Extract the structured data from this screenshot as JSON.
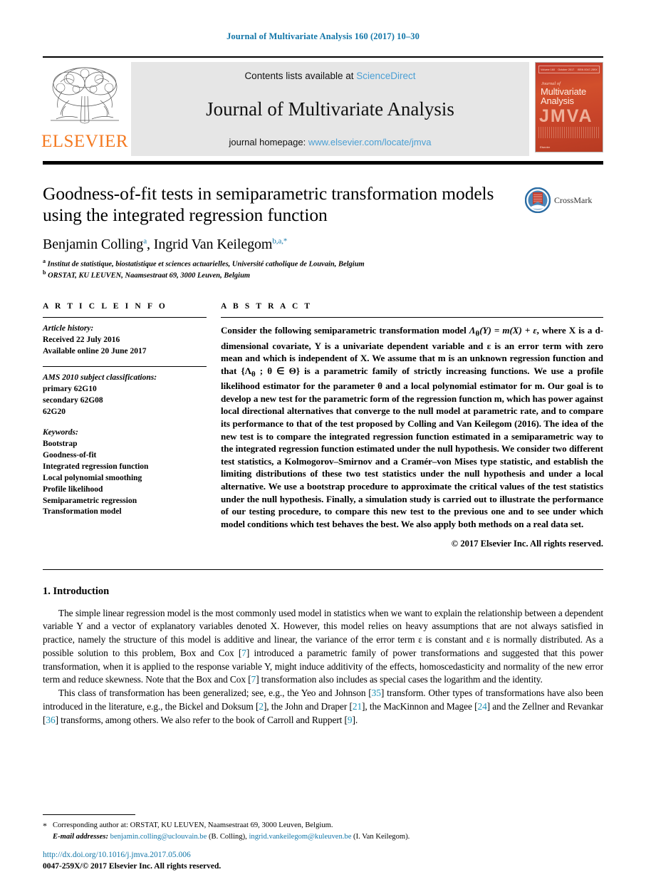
{
  "running_head": "Journal of Multivariate Analysis 160 (2017) 10–30",
  "masthead": {
    "publisher_name": "ELSEVIER",
    "contents_text": "Contents lists available at ",
    "sciencedirect": "ScienceDirect",
    "journal_title": "Journal of Multivariate Analysis",
    "homepage_label": "journal homepage: ",
    "homepage_url": "www.elsevier.com/locate/jmva",
    "cover": {
      "top_bar": [
        "Volume 160",
        "October 2017",
        "ISSN 0047-259X"
      ],
      "journal_of": "Journal of",
      "name_line1": "Multivariate",
      "name_line2": "Analysis",
      "acronym": "JMVA",
      "footer": "Elsevier"
    }
  },
  "article": {
    "title": "Goodness-of-fit tests in semiparametric transformation models using the integrated regression function",
    "authors": "Benjamin Colling , Ingrid Van Keilegom",
    "author1": "Benjamin Colling",
    "author1_sup": "a",
    "author2": "Ingrid Van Keilegom",
    "author2_sup": "b,a,*",
    "affiliation_a_marker": "a",
    "affiliation_a": "Institut de statistique, biostatistique et sciences actuarielles, Université catholique de Louvain, Belgium",
    "affiliation_b_marker": "b",
    "affiliation_b": "ORSTAT, KU LEUVEN, Naamsestraat 69, 3000 Leuven, Belgium",
    "crossmark_label": "CrossMark"
  },
  "article_info": {
    "heading": "A R T I C L E   I N F O",
    "history_label": "Article history:",
    "received": "Received 22 July 2016",
    "available_online": "Available online 20 June 2017",
    "ams_label": "AMS 2010 subject classifications:",
    "ams_primary": "primary 62G10",
    "ams_secondary": "secondary 62G08",
    "ams_extra": "62G20",
    "keywords_label": "Keywords:",
    "keywords": [
      "Bootstrap",
      "Goodness-of-fit",
      "Integrated regression function",
      "Local polynomial smoothing",
      "Profile likelihood",
      "Semiparametric regression",
      "Transformation model"
    ]
  },
  "abstract": {
    "heading": "A B S T R A C T",
    "text_part1": "Consider the following semiparametric transformation model ",
    "math1": "Λ",
    "math1_sub": "θ",
    "math1_rest": "(Y) = m(X) + ε",
    "text_part2": ", where X is a d-dimensional covariate, Y is a univariate dependent variable and ε is an error term with zero mean and which is independent of X. We assume that m is an unknown regression function and that {Λ",
    "math2_sub": "θ",
    "text_part3": " ; θ ∈ Θ} is a parametric family of strictly increasing functions. We use a profile likelihood estimator for the parameter θ and a local polynomial estimator for m. Our goal is to develop a new test for the parametric form of the regression function m, which has power against local directional alternatives that converge to the null model at parametric rate, and to compare its performance to that of the test proposed by Colling and Van Keilegom (2016). The idea of the new test is to compare the integrated regression function estimated in a semiparametric way to the integrated regression function estimated under the null hypothesis. We consider two different test statistics, a Kolmogorov–Smirnov and a Cramér–von Mises type statistic, and establish the limiting distributions of these two test statistics under the null hypothesis and under a local alternative. We use a bootstrap procedure to approximate the critical values of the test statistics under the null hypothesis. Finally, a simulation study is carried out to illustrate the performance of our testing procedure, to compare this new test to the previous one and to see under which model conditions which test behaves the best. We also apply both methods on a real data set.",
    "copyright": "© 2017 Elsevier Inc. All rights reserved."
  },
  "introduction": {
    "heading": "1.  Introduction",
    "para1_a": "The simple linear regression model is the most commonly used model in statistics when we want to explain the relationship between a dependent variable Y and a vector of explanatory variables denoted X. However, this model relies on heavy assumptions that are not always satisfied in practice, namely the structure of this model is additive and linear, the variance of the error term ε is constant and ε is normally distributed. As a possible solution to this problem, Box and Cox [",
    "para1_ref1": "7",
    "para1_b": "] introduced a parametric family of power transformations and suggested that this power transformation, when it is applied to the response variable Y, might induce additivity of the effects, homoscedasticity and normality of the new error term and reduce skewness. Note that the  Box and Cox [",
    "para1_ref2": "7",
    "para1_c": "] transformation also includes as special cases the logarithm and the identity.",
    "para2_a": "This class of transformation has been generalized; see, e.g., the  Yeo and Johnson [",
    "para2_ref1": "35",
    "para2_b": "] transform. Other types of transformations have also been introduced in the literature, e.g., the  Bickel and Doksum [",
    "para2_ref2": "2",
    "para2_c": "], the  John and Draper [",
    "para2_ref3": "21",
    "para2_d": "], the  MacKinnon and Magee [",
    "para2_ref4": "24",
    "para2_e": "] and the  Zellner and Revankar [",
    "para2_ref5": "36",
    "para2_f": "] transforms, among others. We also refer to the book of  Carroll and Ruppert [",
    "para2_ref6": "9",
    "para2_g": "]."
  },
  "footnotes": {
    "star": "*",
    "corresponding": "Corresponding author at: ORSTAT, KU LEUVEN, Naamsestraat 69, 3000 Leuven, Belgium.",
    "email_label": "E-mail addresses:",
    "email1": "benjamin.colling@uclouvain.be",
    "email1_who": "(B. Colling),",
    "email2": "ingrid.vankeilegom@kuleuven.be",
    "email2_who": "(I. Van Keilegom).",
    "doi": "http://dx.doi.org/10.1016/j.jmva.2017.05.006",
    "issn": "0047-259X/© 2017 Elsevier Inc. All rights reserved."
  },
  "colors": {
    "link_blue": "#1276a8",
    "sciencedirect_blue": "#4a9fd4",
    "reference_teal": "#1f92b5",
    "elsevier_orange": "#F47920",
    "banner_gray": "#e6e6e6"
  }
}
